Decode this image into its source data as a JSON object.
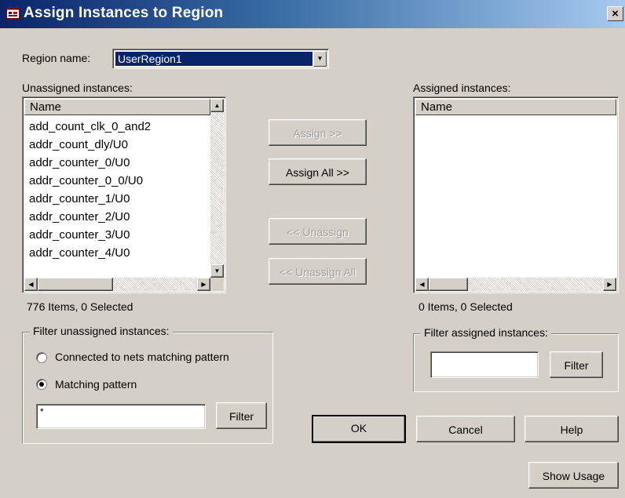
{
  "window": {
    "title": "Assign Instances to Region",
    "close_glyph": "×",
    "icon": "region-icon"
  },
  "region": {
    "label": "Region name:",
    "value": "UserRegion1"
  },
  "unassigned": {
    "label": "Unassigned instances:",
    "column": "Name",
    "items": [
      "add_count_clk_0_and2",
      "addr_count_dly/U0",
      "addr_counter_0/U0",
      "addr_counter_0_0/U0",
      "addr_counter_1/U0",
      "addr_counter_2/U0",
      "addr_counter_3/U0",
      "addr_counter_4/U0"
    ],
    "status": "776 Items, 0 Selected"
  },
  "assigned": {
    "label": "Assigned instances:",
    "column": "Name",
    "items": [],
    "status": "0 Items, 0 Selected"
  },
  "actions": {
    "assign": "Assign >>",
    "assign_all": "Assign All >>",
    "unassign": "<< Unassign",
    "unassign_all": "<< Unassign All"
  },
  "filter_unassigned": {
    "legend": "Filter unassigned instances:",
    "option_nets": "Connected to nets matching pattern",
    "option_pattern": "Matching pattern",
    "selected_option": "Matching pattern",
    "pattern_value": "*",
    "button": "Filter"
  },
  "filter_assigned": {
    "legend": "Filter assigned instances:",
    "pattern_value": "",
    "button": "Filter"
  },
  "footer": {
    "ok": "OK",
    "cancel": "Cancel",
    "help": "Help",
    "show_usage": "Show Usage"
  },
  "colors": {
    "title_gradient_start": "#0a246a",
    "title_gradient_end": "#a6caf0",
    "face": "#d4d0c8",
    "selection": "#0a246a"
  }
}
